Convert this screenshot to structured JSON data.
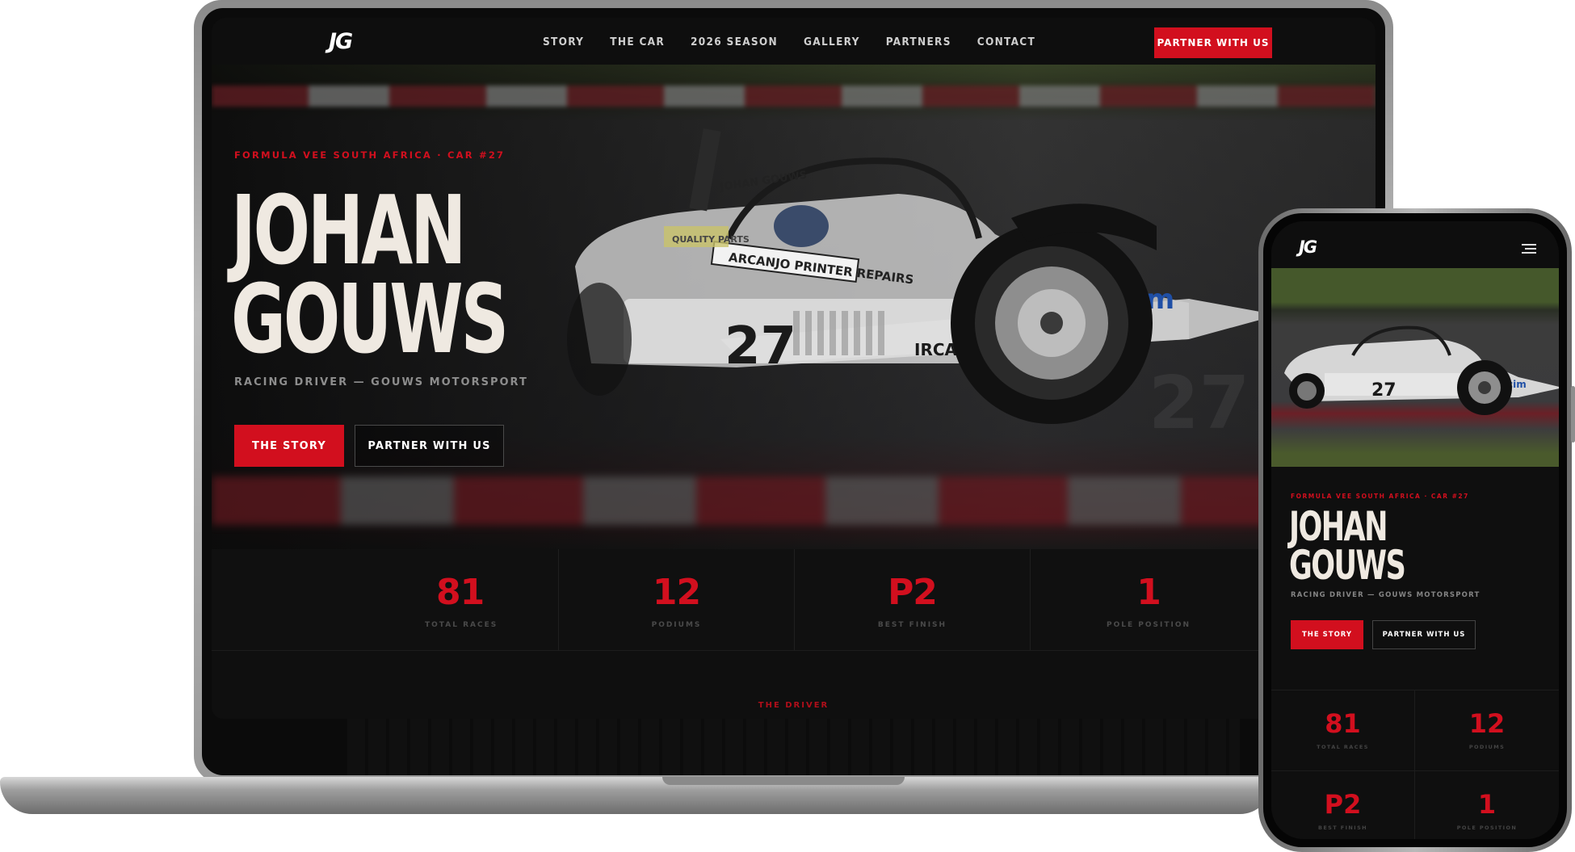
{
  "desktop": {
    "logo": "JG",
    "nav": {
      "links": [
        "STORY",
        "THE CAR",
        "2026 SEASON",
        "GALLERY",
        "PARTNERS",
        "CONTACT"
      ],
      "cta": "PARTNER WITH US"
    },
    "hero": {
      "eyebrow": "FORMULA VEE SOUTH AFRICA  ·  CAR #27",
      "title_line1": "JOHAN",
      "title_line2": "GOUWS",
      "subtitle": "RACING DRIVER — GOUWS MOTORSPORT",
      "primary_button": "THE STORY",
      "secondary_button": "PARTNER WITH US",
      "car_number": "27",
      "car_sponsors": [
        "cim",
        "IRCA",
        "ARCANJO PRINTER REPAIRS",
        "QUALITY PARTS",
        "JOHAN GOUWS"
      ]
    },
    "stats": [
      {
        "value": "81",
        "label": "TOTAL RACES"
      },
      {
        "value": "12",
        "label": "PODIUMS"
      },
      {
        "value": "P2",
        "label": "BEST FINISH"
      },
      {
        "value": "1",
        "label": "POLE POSITION"
      }
    ],
    "next_section": "THE DRIVER"
  },
  "mobile": {
    "logo": "JG",
    "menu_icon": "hamburger-menu-icon",
    "hero": {
      "eyebrow": "FORMULA VEE SOUTH AFRICA  ·  CAR #27",
      "title_line1": "JOHAN",
      "title_line2": "GOUWS",
      "subtitle": "RACING DRIVER — GOUWS MOTORSPORT",
      "primary_button": "THE STORY",
      "secondary_button": "PARTNER WITH US"
    },
    "stats": [
      {
        "value": "81",
        "label": "TOTAL RACES"
      },
      {
        "value": "12",
        "label": "PODIUMS"
      },
      {
        "value": "P2",
        "label": "BEST FINISH"
      },
      {
        "value": "1",
        "label": "POLE POSITION"
      }
    ]
  },
  "colors": {
    "accent": "#d20f1e",
    "background": "#0f0f0f",
    "title": "#efe9e1"
  }
}
